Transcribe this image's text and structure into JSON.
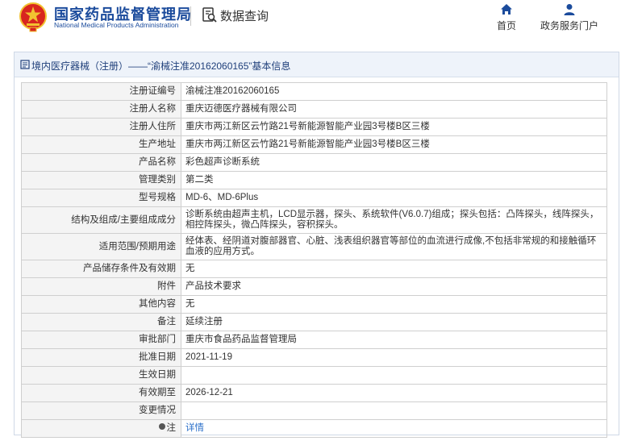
{
  "header": {
    "org_cn": "国家药品监督管理局",
    "org_en": "National Medical Products Administration",
    "query_label": "数据查询",
    "nav": {
      "home": "首页",
      "portal": "政务服务门户"
    }
  },
  "panel": {
    "title": "境内医疗器械（注册）——“渝械注准20162060165”基本信息"
  },
  "rows": [
    {
      "label": "注册证编号",
      "value": "渝械注准20162060165"
    },
    {
      "label": "注册人名称",
      "value": "重庆迈德医疗器械有限公司"
    },
    {
      "label": "注册人住所",
      "value": "重庆市两江新区云竹路21号新能源智能产业园3号楼B区三楼"
    },
    {
      "label": "生产地址",
      "value": "重庆市两江新区云竹路21号新能源智能产业园3号楼B区三楼"
    },
    {
      "label": "产品名称",
      "value": "彩色超声诊断系统"
    },
    {
      "label": "管理类别",
      "value": "第二类"
    },
    {
      "label": "型号规格",
      "value": "MD-6、MD-6Plus"
    },
    {
      "label": "结构及组成/主要组成成分",
      "value": "诊断系统由超声主机，LCD显示器，探头、系统软件(V6.0.7)组成；探头包括：凸阵探头，线阵探头，相控阵探头，微凸阵探头，容积探头。"
    },
    {
      "label": "适用范围/预期用途",
      "value": "经体表、经阴道对腹部器官、心脏、浅表组织器官等部位的血流进行成像,不包括非常规的和接触循环血液的应用方式。"
    },
    {
      "label": "产品储存条件及有效期",
      "value": "无"
    },
    {
      "label": "附件",
      "value": "产品技术要求"
    },
    {
      "label": "其他内容",
      "value": "无"
    },
    {
      "label": "备注",
      "value": "延续注册"
    },
    {
      "label": "审批部门",
      "value": "重庆市食品药品监督管理局"
    },
    {
      "label": "批准日期",
      "value": "2021-11-19"
    },
    {
      "label": "生效日期",
      "value": ""
    },
    {
      "label": "有效期至",
      "value": "2026-12-21"
    },
    {
      "label": "变更情况",
      "value": ""
    },
    {
      "label": "注",
      "value": "详情"
    }
  ],
  "colors": {
    "brand": "#1b4b9c",
    "link": "#2a6fc9",
    "emblem_red": "#d8261f",
    "emblem_gold": "#f2c230"
  }
}
